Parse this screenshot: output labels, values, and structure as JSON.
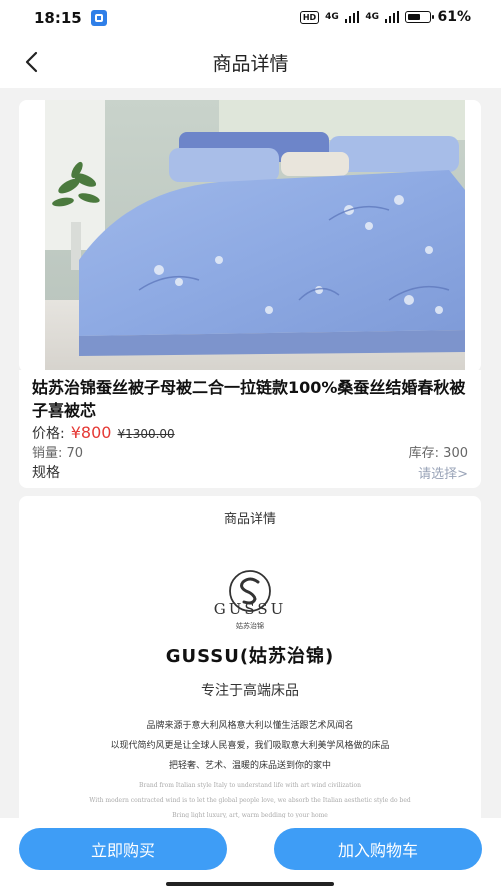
{
  "status_bar": {
    "time": "18:15",
    "hd": "HD",
    "net1": "4G",
    "net2": "4G",
    "battery": "61%"
  },
  "nav": {
    "title": "商品详情"
  },
  "product": {
    "title": "姑苏治锦蚕丝被子母被二合一拉链款100%桑蚕丝结婚春秋被子喜被芯",
    "price_label": "价格:",
    "price": "¥800",
    "original_price": "¥1300.00",
    "sales": "销量: 70",
    "stock": "库存: 300",
    "spec_label": "规格",
    "spec_action": "请选择>"
  },
  "detail": {
    "heading": "商品详情",
    "logo_word": "GUSSU",
    "logo_cn": "姑苏治锦",
    "brand": "GUSSU(姑苏治锦)",
    "slogan": "专注于高端床品",
    "para1": "品牌来源于意大利风格意大利以懂生活跟艺术风闻名",
    "para2": "以现代简约风更是让全球人民喜爱，我们吸取意大利美学风格做的床品",
    "para3": "把轻奢、艺术、温暖的床品送到你的家中",
    "en1": "Brand from Italian style Italy to understand life with art wind civilization",
    "en2": "With modern contracted wind is to let the global people love, we absorb the Italian aesthetic style do bed",
    "en3": "Bring light luxury, art, warm bedding to your home"
  },
  "actions": {
    "buy_now": "立即购买",
    "add_cart": "加入购物车"
  },
  "colors": {
    "accent": "#3e9df6",
    "price": "#e53935"
  }
}
